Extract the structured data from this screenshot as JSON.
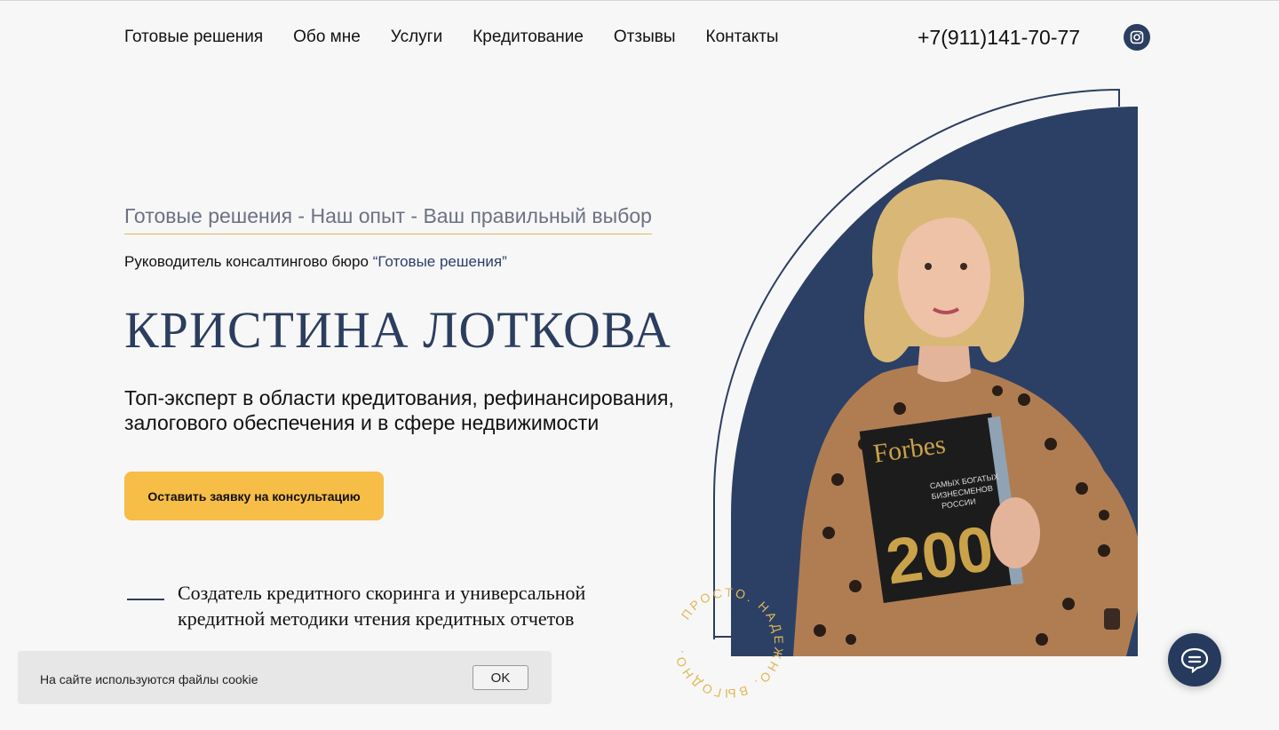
{
  "nav": {
    "items": [
      {
        "label": "Готовые решения"
      },
      {
        "label": "Обо мне"
      },
      {
        "label": "Услуги"
      },
      {
        "label": "Кредитование"
      },
      {
        "label": "Отзывы"
      },
      {
        "label": "Контакты"
      }
    ],
    "phone": "+7(911)141-70-77",
    "social_icon": "instagram-icon"
  },
  "hero": {
    "tagline": "Готовые решения - Наш опыт - Ваш правильный выбор",
    "role_prefix": "Руководитель консалтингово бюро ",
    "role_company": "“Готовые решения”",
    "name": "КРИСТИНА ЛОТКОВА",
    "expertise": "Топ-эксперт в области кредитования, рефинансирования, залогового обеспечения и в сфере недвижимости",
    "cta_label": "Оставить заявку на консультацию",
    "feature_text": "Создатель кредитного скоринга и универсальной кредитной методики чтения кредитных отчетов",
    "badge_text": "ПРОСТО. НАДЕЖНО. ВЫГОДНО."
  },
  "magazine": {
    "title": "Forbes",
    "subtitle": "САМЫХ БОГАТЫХ БИЗНЕСМЕНОВ РОССИИ",
    "number": "200"
  },
  "cookie": {
    "text": "На сайте используются файлы cookie",
    "ok_label": "OK"
  },
  "colors": {
    "accent": "#f6bd47",
    "navy": "#2c3e5f",
    "background": "#f7f7f7"
  },
  "chat": {
    "icon": "chat-icon"
  }
}
